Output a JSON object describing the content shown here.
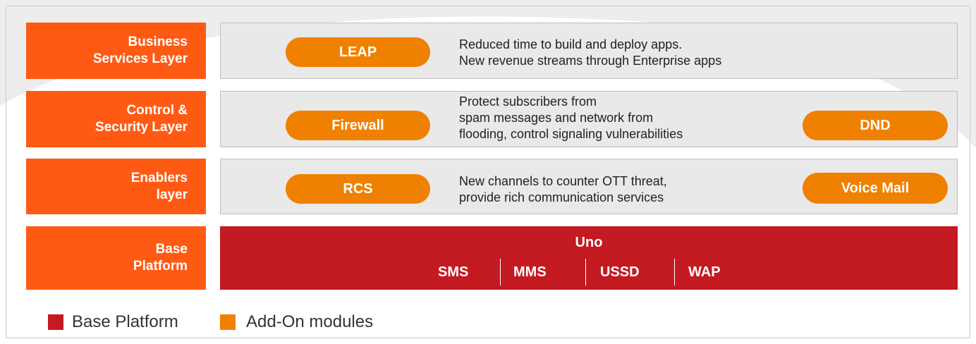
{
  "layers": [
    {
      "label_lines": [
        "Business",
        "Services Layer"
      ],
      "modules": [
        "LEAP"
      ],
      "description_lines": [
        "Reduced time to build and deploy apps.",
        "New revenue streams through Enterprise apps"
      ]
    },
    {
      "label_lines": [
        "Control &",
        "Security Layer"
      ],
      "modules": [
        "Firewall",
        "DND"
      ],
      "description_lines": [
        "Protect subscribers from",
        "spam messages and network from",
        "flooding, control signaling vulnerabilities"
      ]
    },
    {
      "label_lines": [
        "Enablers",
        "layer"
      ],
      "modules": [
        "RCS",
        "Voice Mail"
      ],
      "description_lines": [
        "New channels to counter OTT threat,",
        "provide rich communication services"
      ]
    }
  ],
  "base": {
    "label_lines": [
      "Base",
      "Platform"
    ],
    "title": "Uno",
    "protocols": [
      "SMS",
      "MMS",
      "USSD",
      "WAP"
    ]
  },
  "legend": [
    {
      "label": "Base Platform",
      "color": "#c41a22"
    },
    {
      "label": "Add-On modules",
      "color": "#f08000"
    }
  ],
  "colors": {
    "layer_label": "#ff5a14",
    "add_on": "#f08000",
    "base": "#c41a22",
    "panel": "#e9e9e9"
  }
}
